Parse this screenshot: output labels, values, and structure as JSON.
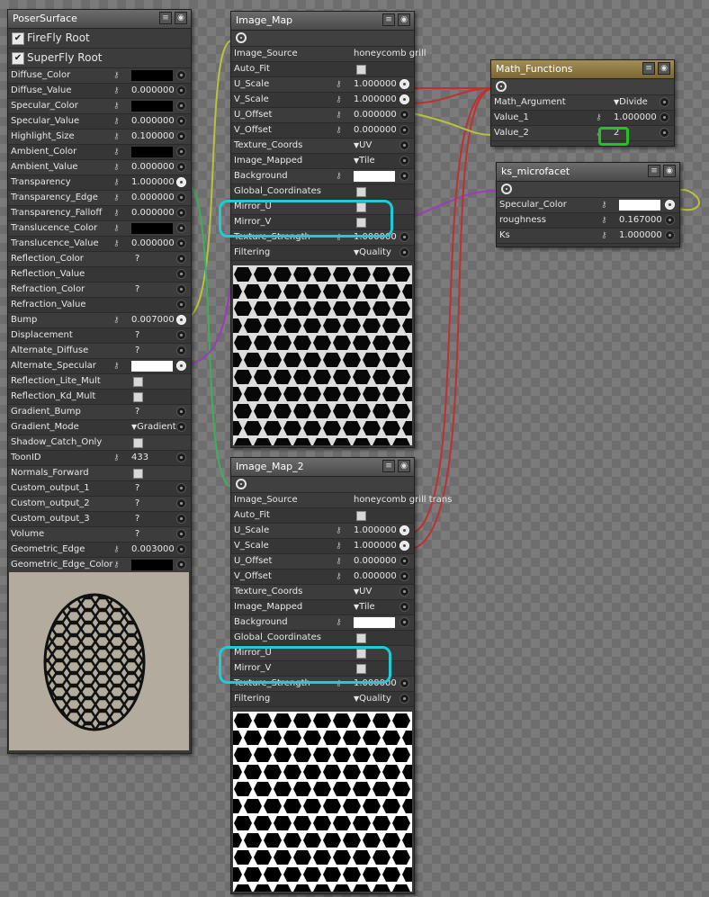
{
  "poser": {
    "title": "PoserSurface",
    "checks": [
      "FireFly Root",
      "SuperFly Root"
    ],
    "rows": [
      {
        "label": "Diffuse_Color",
        "type": "swatch",
        "color": "#000000"
      },
      {
        "label": "Diffuse_Value",
        "type": "num",
        "value": "0.000000"
      },
      {
        "label": "Specular_Color",
        "type": "swatch",
        "color": "#000000"
      },
      {
        "label": "Specular_Value",
        "type": "num",
        "value": "0.000000"
      },
      {
        "label": "Highlight_Size",
        "type": "num",
        "value": "0.100000"
      },
      {
        "label": "Ambient_Color",
        "type": "swatch",
        "color": "#000000"
      },
      {
        "label": "Ambient_Value",
        "type": "num",
        "value": "0.000000"
      },
      {
        "label": "Transparency",
        "type": "num",
        "value": "1.000000",
        "conn": true
      },
      {
        "label": "Transparency_Edge",
        "type": "num",
        "value": "0.000000"
      },
      {
        "label": "Transparency_Falloff",
        "type": "num",
        "value": "0.000000"
      },
      {
        "label": "Translucence_Color",
        "type": "swatch",
        "color": "#000000"
      },
      {
        "label": "Translucence_Value",
        "type": "num",
        "value": "0.000000"
      },
      {
        "label": "Reflection_Color",
        "type": "q"
      },
      {
        "label": "Reflection_Value",
        "type": "blank"
      },
      {
        "label": "Refraction_Color",
        "type": "q"
      },
      {
        "label": "Refraction_Value",
        "type": "blank"
      },
      {
        "label": "Bump",
        "type": "num",
        "value": "0.007000",
        "conn": true
      },
      {
        "label": "Displacement",
        "type": "q"
      },
      {
        "label": "Alternate_Diffuse",
        "type": "q"
      },
      {
        "label": "Alternate_Specular",
        "type": "swatch",
        "color": "#ffffff",
        "conn": true
      },
      {
        "label": "Reflection_Lite_Mult",
        "type": "cb"
      },
      {
        "label": "Reflection_Kd_Mult",
        "type": "cb"
      },
      {
        "label": "Gradient_Bump",
        "type": "q"
      },
      {
        "label": "Gradient_Mode",
        "type": "dd",
        "value": "Gradient B"
      },
      {
        "label": "Shadow_Catch_Only",
        "type": "cb"
      },
      {
        "label": "ToonID",
        "type": "num",
        "value": "433"
      },
      {
        "label": "Normals_Forward",
        "type": "cb"
      },
      {
        "label": "Custom_output_1",
        "type": "q"
      },
      {
        "label": "Custom_output_2",
        "type": "q"
      },
      {
        "label": "Custom_output_3",
        "type": "q"
      },
      {
        "label": "Volume",
        "type": "q"
      },
      {
        "label": "Geometric_Edge",
        "type": "num",
        "value": "0.003000"
      },
      {
        "label": "Geometric_Edge_Color",
        "type": "swatch",
        "color": "#000000"
      }
    ]
  },
  "image_map_1": {
    "title": "Image_Map",
    "rows": [
      {
        "label": "Image_Source",
        "type": "text",
        "value": "honeycomb grill"
      },
      {
        "label": "Auto_Fit",
        "type": "cb"
      },
      {
        "label": "U_Scale",
        "type": "num",
        "value": "1.000000",
        "conn": true
      },
      {
        "label": "V_Scale",
        "type": "num",
        "value": "1.000000",
        "conn": true
      },
      {
        "label": "U_Offset",
        "type": "num",
        "value": "0.000000"
      },
      {
        "label": "V_Offset",
        "type": "num",
        "value": "0.000000"
      },
      {
        "label": "Texture_Coords",
        "type": "dd",
        "value": "UV"
      },
      {
        "label": "Image_Mapped",
        "type": "dd",
        "value": "Tile"
      },
      {
        "label": "Background",
        "type": "swatch",
        "color": "#ffffff"
      },
      {
        "label": "Global_Coordinates",
        "type": "cb"
      },
      {
        "label": "Mirror_U",
        "type": "cb"
      },
      {
        "label": "Mirror_V",
        "type": "cb"
      },
      {
        "label": "Texture_Strength",
        "type": "num",
        "value": "1.000000"
      },
      {
        "label": "Filtering",
        "type": "dd",
        "value": "Quality"
      }
    ]
  },
  "image_map_2": {
    "title": "Image_Map_2",
    "rows": [
      {
        "label": "Image_Source",
        "type": "text",
        "value": "honeycomb grill trans"
      },
      {
        "label": "Auto_Fit",
        "type": "cb"
      },
      {
        "label": "U_Scale",
        "type": "num",
        "value": "1.000000",
        "conn": true
      },
      {
        "label": "V_Scale",
        "type": "num",
        "value": "1.000000",
        "conn": true
      },
      {
        "label": "U_Offset",
        "type": "num",
        "value": "0.000000"
      },
      {
        "label": "V_Offset",
        "type": "num",
        "value": "0.000000"
      },
      {
        "label": "Texture_Coords",
        "type": "dd",
        "value": "UV"
      },
      {
        "label": "Image_Mapped",
        "type": "dd",
        "value": "Tile"
      },
      {
        "label": "Background",
        "type": "swatch",
        "color": "#ffffff"
      },
      {
        "label": "Global_Coordinates",
        "type": "cb"
      },
      {
        "label": "Mirror_U",
        "type": "cb"
      },
      {
        "label": "Mirror_V",
        "type": "cb"
      },
      {
        "label": "Texture_Strength",
        "type": "num",
        "value": "1.000000"
      },
      {
        "label": "Filtering",
        "type": "dd",
        "value": "Quality"
      }
    ]
  },
  "math": {
    "title": "Math_Functions",
    "rows": [
      {
        "label": "Math_Argument",
        "type": "dd",
        "value": "Divide"
      },
      {
        "label": "Value_1",
        "type": "num",
        "value": "1.000000"
      },
      {
        "label": "Value_2",
        "type": "num",
        "value": "2"
      }
    ]
  },
  "ks": {
    "title": "ks_microfacet",
    "rows": [
      {
        "label": "Specular_Color",
        "type": "swatch",
        "color": "#ffffff",
        "conn": true
      },
      {
        "label": "roughness",
        "type": "num",
        "value": "0.167000"
      },
      {
        "label": "Ks",
        "type": "num",
        "value": "1.000000"
      }
    ]
  },
  "icons": {
    "menu": "menu-icon",
    "eye": "eye-icon",
    "output": "output-port-icon",
    "key": "key-icon",
    "socket": "input-socket-icon"
  },
  "colors": {
    "wire_red": "#c03030",
    "wire_yellow": "#b9c23c",
    "wire_green": "#3fae5a",
    "wire_purple": "#9a3db8",
    "highlight_cyan": "#1ecbd6",
    "highlight_green": "#22c422"
  }
}
